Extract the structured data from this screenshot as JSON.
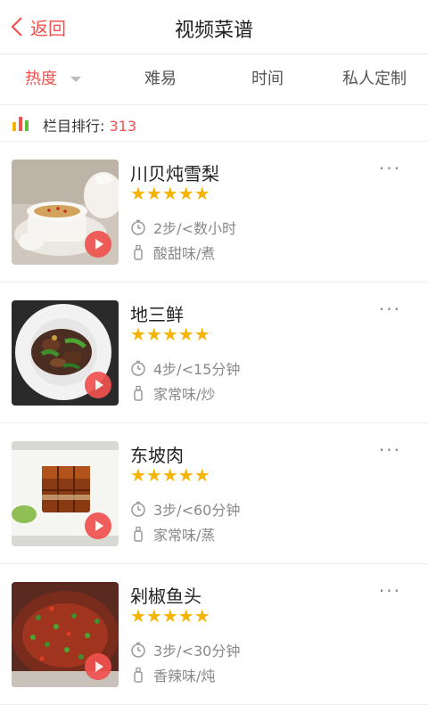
{
  "header": {
    "back_label": "返回",
    "title": "视频菜谱"
  },
  "tabs": [
    {
      "label": "热度",
      "active": true
    },
    {
      "label": "难易",
      "active": false
    },
    {
      "label": "时间",
      "active": false
    },
    {
      "label": "私人定制",
      "active": false
    }
  ],
  "rank": {
    "label": "栏目排行: ",
    "count": "313"
  },
  "recipes": [
    {
      "name": "川贝炖雪梨",
      "stars": "★★★★★",
      "steps_time": "2步/<数小时",
      "flavor_method": "酸甜味/煮"
    },
    {
      "name": "地三鲜",
      "stars": "★★★★★",
      "steps_time": "4步/<15分钟",
      "flavor_method": "家常味/炒"
    },
    {
      "name": "东坡肉",
      "stars": "★★★★★",
      "steps_time": "3步/<60分钟",
      "flavor_method": "家常味/蒸"
    },
    {
      "name": "剁椒鱼头",
      "stars": "★★★★★",
      "steps_time": "3步/<30分钟",
      "flavor_method": "香辣味/炖"
    }
  ],
  "more_label": "···",
  "colors": {
    "accent": "#f0524f",
    "star": "#f5b400",
    "muted": "#888888"
  },
  "icons": {
    "back": "chevron-left-icon",
    "rank": "bar-chart-icon",
    "time": "clock-icon",
    "flavor": "bottle-icon",
    "play": "play-icon",
    "more": "more-dots-icon"
  }
}
